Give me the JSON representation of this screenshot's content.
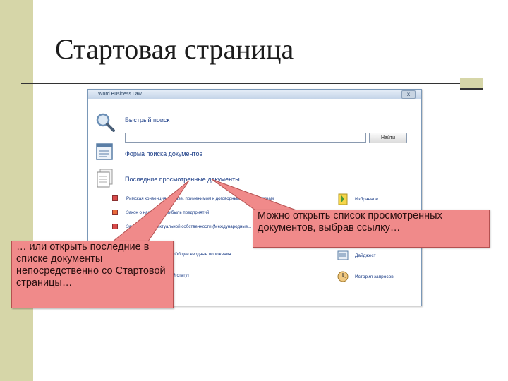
{
  "slide": {
    "title": "Стартовая страница",
    "accent_color": "#d6d6a8"
  },
  "window": {
    "title": "Word Business Law",
    "close_label": "x",
    "search": {
      "label": "Быстрый поиск",
      "value": "",
      "button_label": "Найти"
    },
    "sections": [
      {
        "label": "Форма поиска документов",
        "icon": "form-search-icon"
      },
      {
        "label": "Последние просмотренные документы",
        "icon": "recent-docs-icon"
      }
    ],
    "recent_documents": [
      {
        "label": "Римская конвенция о праве, применимом к договорным обязательствам"
      },
      {
        "label": "Закон о налоге на прибыль предприятий"
      },
      {
        "label": "Закон о интеллектуальной собственности (Международные..."
      },
      {
        "label": "...положения."
      },
      {
        "label": "...кодекс 2006. Часть 1. Общие вводные положения."
      },
      {
        "label": "...Книга I: Коммерческий статут"
      }
    ],
    "side_links": [
      {
        "label": "Избранное",
        "icon": "favorites-icon"
      },
      {
        "label": "Дайджест",
        "icon": "digest-icon"
      },
      {
        "label": "История запросов",
        "icon": "history-icon"
      }
    ]
  },
  "callouts": {
    "right": "Можно открыть список просмотренных документов, выбрав ссылку…",
    "left": "… или открыть последние в списке документы непосредственно со Стартовой страницы…",
    "fill_color": "#f08a8a"
  }
}
